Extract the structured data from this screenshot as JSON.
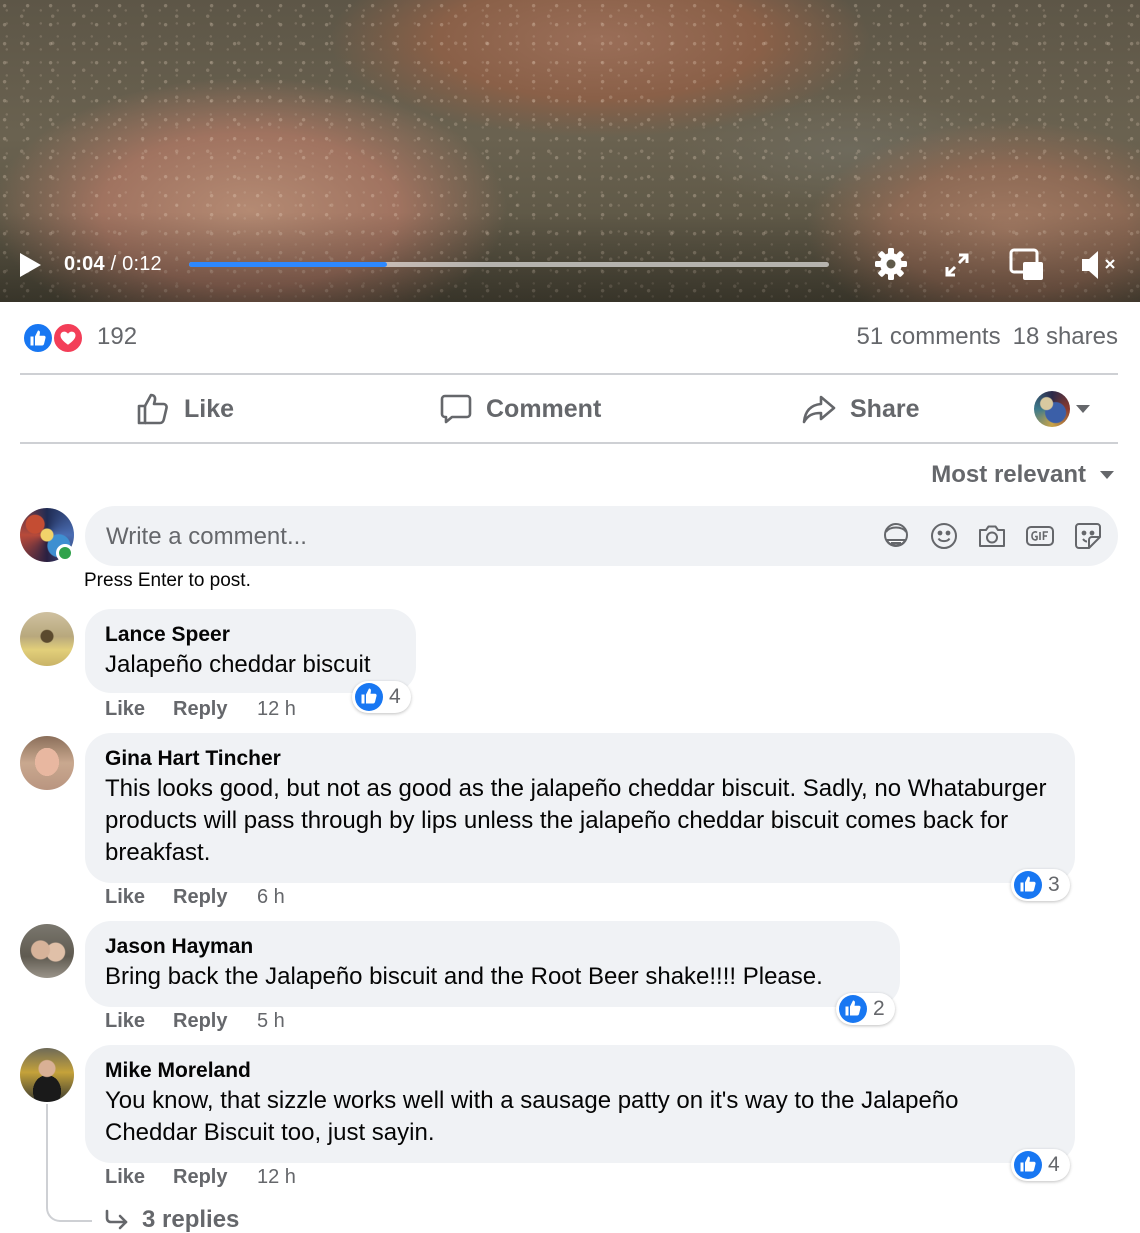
{
  "video": {
    "current_time": "0:04",
    "separator": " / ",
    "duration": "0:12",
    "progress": 0.31
  },
  "stats": {
    "reactions": [
      "like",
      "love"
    ],
    "reaction_count": "192",
    "comments": "51 comments",
    "shares": "18 shares"
  },
  "actions": {
    "like": "Like",
    "comment": "Comment",
    "share": "Share"
  },
  "sort": {
    "label": "Most relevant"
  },
  "composer": {
    "placeholder": "Write a comment...",
    "hint": "Press Enter to post.",
    "tools": [
      "avatar-sticker-icon",
      "emoji-icon",
      "camera-icon",
      "gif-icon",
      "sticker-icon"
    ]
  },
  "colors": {
    "accent": "#1877f2",
    "love": "#f33e58",
    "progress": "#2d88ff",
    "bubble": "#f0f2f5",
    "secondary_text": "#65676b",
    "online": "#31a24c"
  },
  "comments": [
    {
      "author": "Lance Speer",
      "text": "Jalapeño cheddar biscuit",
      "like_label": "Like",
      "reply_label": "Reply",
      "time": "12 h",
      "reactions": "4"
    },
    {
      "author": "Gina Hart Tincher",
      "text": "This looks good, but not as good as the jalapeño cheddar biscuit. Sadly, no Whataburger products will pass through by lips unless the jalapeño cheddar biscuit comes back for breakfast.",
      "like_label": "Like",
      "reply_label": "Reply",
      "time": "6 h",
      "reactions": "3"
    },
    {
      "author": "Jason Hayman",
      "text": "Bring back the Jalapeño biscuit and the Root Beer shake!!!! Please.",
      "like_label": "Like",
      "reply_label": "Reply",
      "time": "5 h",
      "reactions": "2"
    },
    {
      "author": "Mike Moreland",
      "text": "You know, that sizzle works well with a sausage patty on it's way to the Jalapeño Cheddar Biscuit too, just sayin.",
      "like_label": "Like",
      "reply_label": "Reply",
      "time": "12 h",
      "reactions": "4",
      "replies": "3 replies"
    }
  ]
}
